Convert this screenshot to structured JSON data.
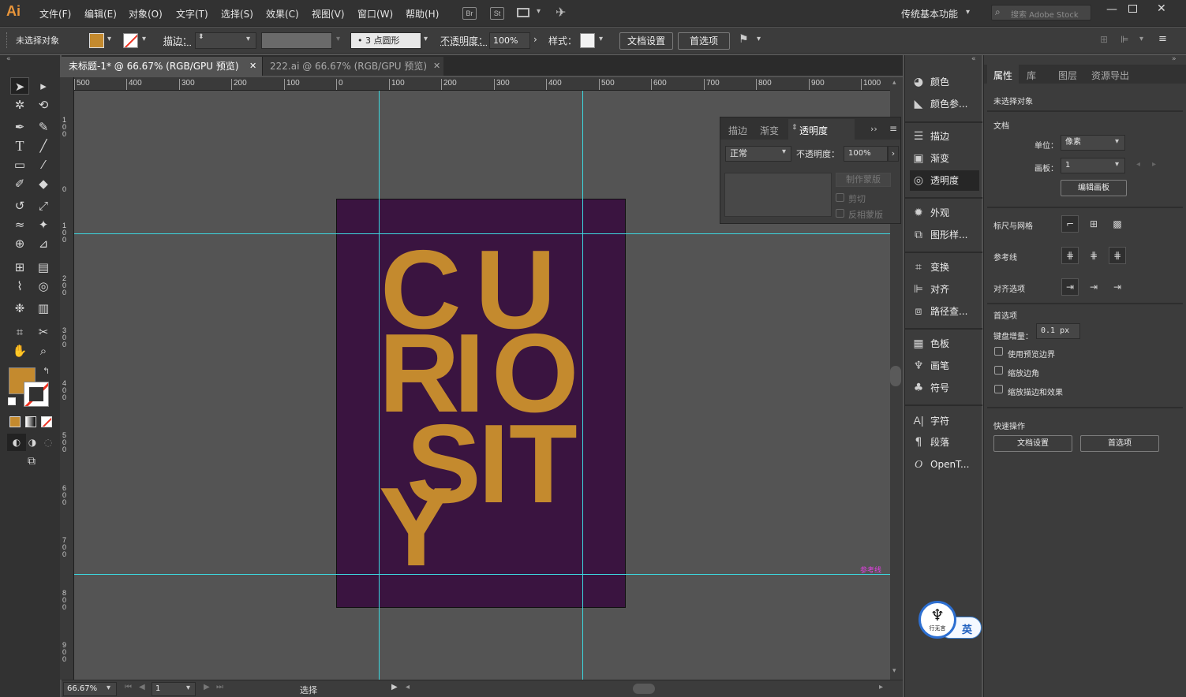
{
  "app": {
    "logo": "Ai"
  },
  "menu": [
    "文件(F)",
    "编辑(E)",
    "对象(O)",
    "文字(T)",
    "选择(S)",
    "效果(C)",
    "视图(V)",
    "窗口(W)",
    "帮助(H)"
  ],
  "appbar": {
    "br": "Br",
    "st": "St",
    "workspace": "传统基本功能",
    "search_placeholder": "搜索 Adobe Stock"
  },
  "control": {
    "no_selection": "未选择对象",
    "stroke_label": "描边：",
    "brush_label": "3 点圆形",
    "opacity_label": "不透明度：",
    "opacity_value": "100%",
    "style_label": "样式：",
    "doc_setup": "文档设置",
    "prefs": "首选项",
    "fill_color": "#c48a2e"
  },
  "tabs": [
    {
      "label": "未标题-1* @ 66.67% (RGB/GPU 预览)",
      "active": true
    },
    {
      "label": "222.ai @ 66.67% (RGB/GPU 预览)",
      "active": false
    }
  ],
  "ruler_h": [
    "500",
    "400",
    "300",
    "200",
    "100",
    "0",
    "100",
    "200",
    "300",
    "400",
    "500",
    "600",
    "700",
    "800",
    "900",
    "1000"
  ],
  "ruler_v": [
    "100",
    "0",
    "100",
    "200",
    "300",
    "400",
    "500",
    "600",
    "700",
    "800",
    "900"
  ],
  "artwork": {
    "bg": "#3a1440",
    "text_color": "#c48a2e",
    "letters": [
      "C",
      "U",
      "R",
      "I",
      "O",
      "S",
      "I",
      "T",
      "Y"
    ]
  },
  "guide_label": "参考线",
  "status": {
    "zoom": "66.67%",
    "page": "1",
    "tool": "选择"
  },
  "float_panel": {
    "tabs": [
      "描边",
      "渐变",
      "透明度"
    ],
    "blend": "正常",
    "opacity_label": "不透明度：",
    "opacity_value": "100%",
    "make_mask": "制作蒙版",
    "clip": "剪切",
    "invert": "反相蒙版"
  },
  "icon_panel": [
    {
      "label": "颜色",
      "icon": "color-icon"
    },
    {
      "label": "颜色参...",
      "icon": "color-guide-icon"
    },
    {
      "label": "描边",
      "icon": "stroke-icon"
    },
    {
      "label": "渐变",
      "icon": "gradient-icon"
    },
    {
      "label": "透明度",
      "icon": "transparency-icon"
    },
    {
      "label": "外观",
      "icon": "appearance-icon"
    },
    {
      "label": "图形样...",
      "icon": "graphic-styles-icon"
    },
    {
      "label": "变换",
      "icon": "transform-icon"
    },
    {
      "label": "对齐",
      "icon": "align-icon"
    },
    {
      "label": "路径查...",
      "icon": "pathfinder-icon"
    },
    {
      "label": "色板",
      "icon": "swatches-icon"
    },
    {
      "label": "画笔",
      "icon": "brushes-icon"
    },
    {
      "label": "符号",
      "icon": "symbols-icon"
    },
    {
      "label": "字符",
      "icon": "character-icon"
    },
    {
      "label": "段落",
      "icon": "paragraph-icon"
    },
    {
      "label": "OpenT...",
      "icon": "opentype-icon"
    }
  ],
  "props": {
    "tabs": [
      "属性",
      "库",
      "图层",
      "资源导出"
    ],
    "no_selection": "未选择对象",
    "doc_head": "文档",
    "unit_label": "单位：",
    "unit_value": "像素",
    "artboard_label": "画板：",
    "artboard_value": "1",
    "edit_artboard": "编辑画板",
    "rulers_grids": "标尺与网格",
    "guides": "参考线",
    "snap": "对齐选项",
    "prefs_head": "首选项",
    "key_inc_label": "键盘增量：",
    "key_inc_value": "0.1 px",
    "use_preview": "使用预览边界",
    "scale_corners": "缩放边角",
    "scale_strokes": "缩放描边和效果",
    "quick_actions": "快速操作",
    "qa_doc_setup": "文档设置",
    "qa_prefs": "首选项"
  },
  "ime": {
    "label": "英",
    "avatar_text": "行无言"
  }
}
